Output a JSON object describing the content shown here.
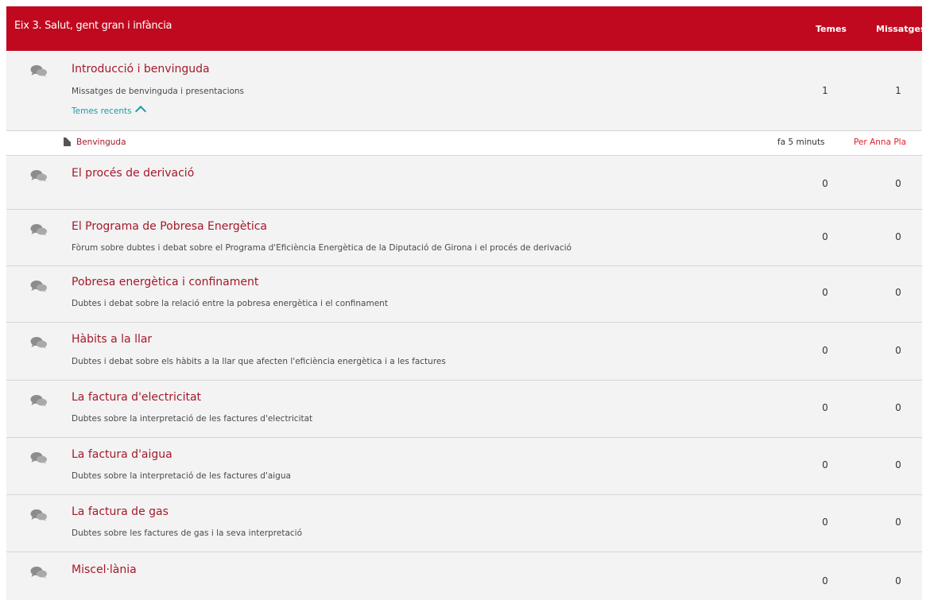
{
  "header": {
    "title": "Eix 3. Salut, gent gran i infància",
    "col_topics": "Temes",
    "col_posts": "Missatges"
  },
  "forums": [
    {
      "name": "Introducció i benvinguda",
      "description": "Missatges de benvinguda i presentacions",
      "topics": "1",
      "posts": "1",
      "recent_toggle": "Temes recents",
      "recent": {
        "topic": "Benvinguda",
        "time": "fa 5 minuts",
        "author": "Per Anna Pla"
      }
    },
    {
      "name": "El procés de derivació",
      "description": "",
      "topics": "0",
      "posts": "0"
    },
    {
      "name": "El Programa de Pobresa Energètica",
      "description": "Fòrum sobre dubtes i debat sobre el Programa d'Eficiència Energètica de la Diputació de Girona i el procés de derivació",
      "topics": "0",
      "posts": "0"
    },
    {
      "name": "Pobresa energètica i confinament",
      "description": "Dubtes i debat sobre la relació entre la pobresa energètica i el confinament",
      "topics": "0",
      "posts": "0"
    },
    {
      "name": "Hàbits a la llar",
      "description": "Dubtes i debat sobre els hàbits a la llar que afecten l'eficiència energètica i a les factures",
      "topics": "0",
      "posts": "0"
    },
    {
      "name": "La factura d'electricitat",
      "description": "Dubtes sobre la interpretació de les factures d'electricitat",
      "topics": "0",
      "posts": "0"
    },
    {
      "name": "La factura d'aigua",
      "description": "Dubtes sobre la interpretació de les factures d'aigua",
      "topics": "0",
      "posts": "0"
    },
    {
      "name": "La factura de gas",
      "description": "Dubtes sobre les factures de gas i la seva interpretació",
      "topics": "0",
      "posts": "0"
    },
    {
      "name": "Miscel·lània",
      "description": "",
      "topics": "0",
      "posts": "0"
    }
  ],
  "colors": {
    "header_bg": "#c0091f",
    "link": "#a5192a",
    "accent": "#1f9ba6",
    "author": "#e0202f"
  },
  "icons": {
    "forum": "chat-bubbles-icon",
    "topic": "document-icon",
    "toggle": "chevron-up-icon"
  }
}
